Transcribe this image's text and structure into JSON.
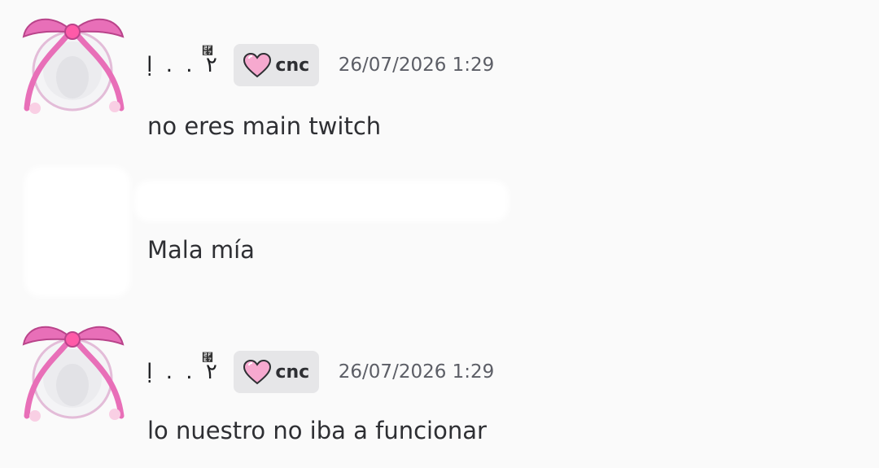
{
  "messages": [
    {
      "username": "ḷ . . ٢",
      "bow_decoration": "⿧",
      "tag": {
        "icon": "pink-heart-icon",
        "label": "cnc"
      },
      "timestamp": "26/07/2026 1:29",
      "text": "no eres main twitch",
      "avatar_icon": "pink-ribbon-frame-avatar"
    },
    {
      "text": "Mala mía",
      "author_redacted": true
    },
    {
      "username": "ḷ . . ٢",
      "bow_decoration": "⿧",
      "tag": {
        "icon": "pink-heart-icon",
        "label": "cnc"
      },
      "timestamp": "26/07/2026 1:29",
      "text": "lo nuestro no iba a funcionar",
      "avatar_icon": "pink-ribbon-frame-avatar"
    }
  ],
  "colors": {
    "background": "#fafafa",
    "tag_bg": "#e6e6e8",
    "ribbon_pink": "#e86fb8",
    "heart_pink": "#f6a9cf",
    "timestamp": "#5c5e66"
  }
}
